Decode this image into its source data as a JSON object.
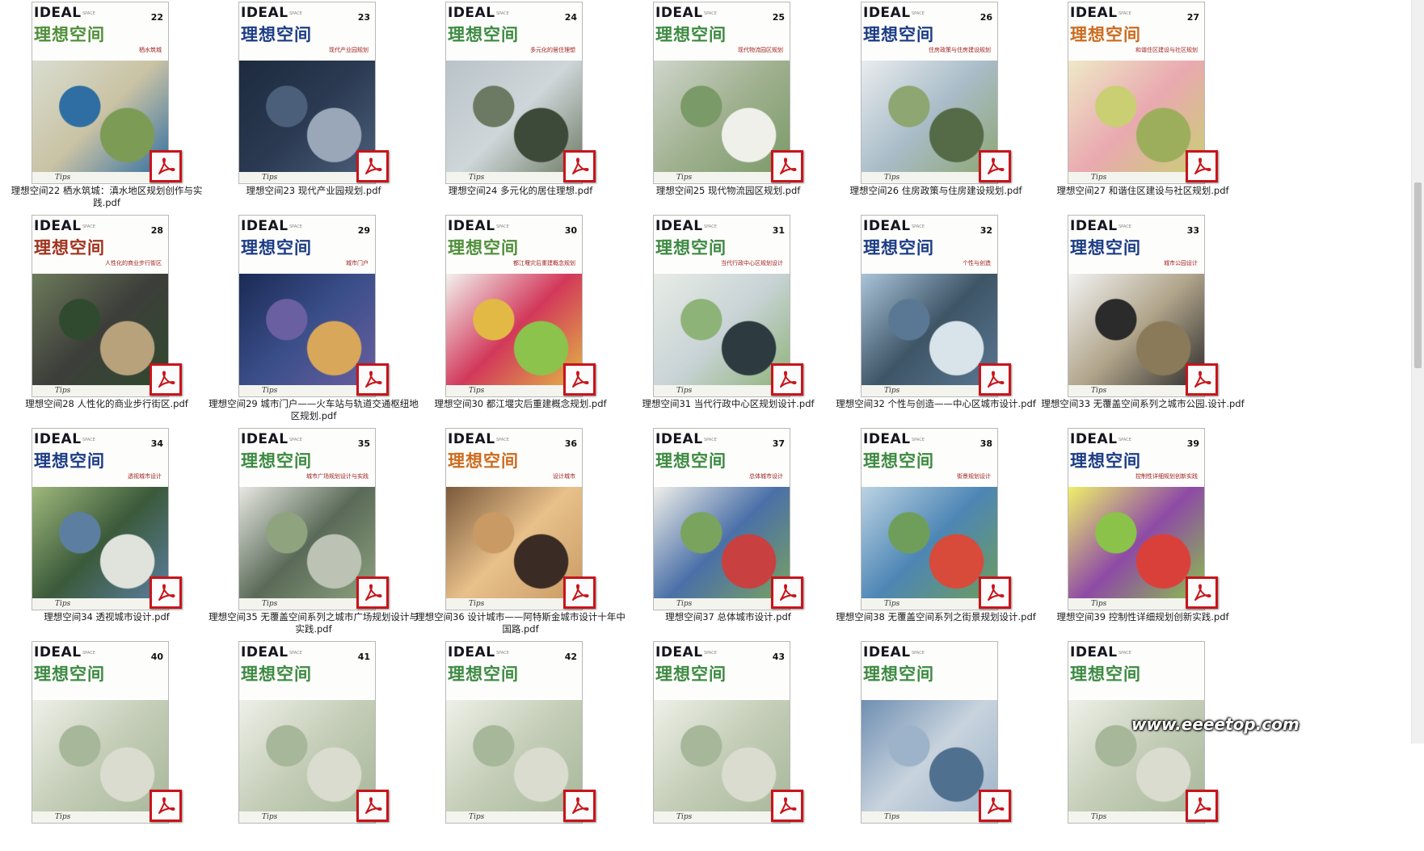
{
  "cover": {
    "brand": "IDEAL",
    "space_word": "SPACE",
    "cn_title": "理想空间",
    "tips": "Tips"
  },
  "files": [
    {
      "issue": "22",
      "subtitle": "栖水筑城",
      "filename": "理想空间22 栖水筑城：滇水地区规划创作与实践.pdf",
      "title_color": "#4f8f3a",
      "palette": [
        "#d9ddd0",
        "#2f6ea2",
        "#7c9b54",
        "#c9c2a4"
      ]
    },
    {
      "issue": "23",
      "subtitle": "现代产业园规划",
      "filename": "理想空间23 现代产业园规划.pdf",
      "title_color": "#1c3c86",
      "palette": [
        "#1d2a3e",
        "#4c5f7a",
        "#9aa7b8",
        "#2b3a52"
      ]
    },
    {
      "issue": "24",
      "subtitle": "多元化的居住理想",
      "filename": "理想空间24 多元化的居住理想.pdf",
      "title_color": "#3d8a42",
      "palette": [
        "#b9c3c9",
        "#6d7a63",
        "#3d4a3a",
        "#cfd6d9"
      ]
    },
    {
      "issue": "25",
      "subtitle": "现代物流园区规划",
      "filename": "理想空间25 现代物流园区规划.pdf",
      "title_color": "#3d8a42",
      "palette": [
        "#cfd5cb",
        "#7a9a68",
        "#f0f0ea",
        "#9fb08f"
      ]
    },
    {
      "issue": "26",
      "subtitle": "住房政策与住房建设规划",
      "filename": "理想空间26 住房政策与住房建设规划.pdf",
      "title_color": "#1c3c86",
      "palette": [
        "#e9ecef",
        "#8ea671",
        "#556b48",
        "#a9bcc8"
      ]
    },
    {
      "issue": "27",
      "subtitle": "和谐住区建设与社区规划",
      "filename": "理想空间27 和谐住区建设与社区规划.pdf",
      "title_color": "#cc6b1f",
      "palette": [
        "#eee9c6",
        "#c9cf72",
        "#9cae5c",
        "#e9a9b0"
      ]
    },
    {
      "issue": "28",
      "subtitle": "人性化的商业步行街区",
      "filename": "理想空间28 人性化的商业步行街区.pdf",
      "title_color": "#a0331f",
      "palette": [
        "#6c7a5a",
        "#2f4a2e",
        "#b7a27b",
        "#3d3e3a"
      ]
    },
    {
      "issue": "29",
      "subtitle": "城市门户",
      "filename": "理想空间29 城市门户——火车站与轨道交通枢纽地区规划.pdf",
      "title_color": "#1c3c86",
      "palette": [
        "#1b2a55",
        "#6a5fa0",
        "#d9a75a",
        "#3b4f8a"
      ]
    },
    {
      "issue": "30",
      "subtitle": "都江堰灾后重建概念规划",
      "filename": "理想空间30 都江堰灾后重建概念规划.pdf",
      "title_color": "#4f8f3a",
      "palette": [
        "#f2f2ee",
        "#e2b945",
        "#8cc34c",
        "#d2385a"
      ]
    },
    {
      "issue": "31",
      "subtitle": "当代行政中心区规划设计",
      "filename": "理想空间31 当代行政中心区规划设计.pdf",
      "title_color": "#3d8a42",
      "palette": [
        "#e7ece5",
        "#8db379",
        "#2d3a3f",
        "#c9d3d6"
      ]
    },
    {
      "issue": "32",
      "subtitle": "个性与创造",
      "filename": "理想空间32 个性与创造——中心区城市设计.pdf",
      "title_color": "#1c3c86",
      "palette": [
        "#a9c3d9",
        "#5a7893",
        "#d8e3ea",
        "#3e5566"
      ]
    },
    {
      "issue": "33",
      "subtitle": "城市公园设计",
      "filename": "理想空间33 无覆盖空间系列之城市公园.设计.pdf",
      "title_color": "#1c3c86",
      "palette": [
        "#f2f2f2",
        "#2b2b2b",
        "#8a7a5a",
        "#b0a48a"
      ]
    },
    {
      "issue": "34",
      "subtitle": "透视城市设计",
      "filename": "理想空间34 透视城市设计.pdf",
      "title_color": "#1c3c86",
      "palette": [
        "#9fb87c",
        "#5c7fa1",
        "#dfe3dc",
        "#3b5a3a"
      ]
    },
    {
      "issue": "35",
      "subtitle": "城市广场规划设计与实践",
      "filename": "理想空间35 无覆盖空间系列之城市广场规划设计与实践.pdf",
      "title_color": "#3d8a42",
      "palette": [
        "#e7e8e2",
        "#8fa37f",
        "#bcc3b4",
        "#5a6a58"
      ]
    },
    {
      "issue": "36",
      "subtitle": "设计城市",
      "filename": "理想空间36 设计城市——阿特斯金城市设计十年中国路.pdf",
      "title_color": "#cc6b1f",
      "palette": [
        "#7b5a3c",
        "#c99a64",
        "#3a2c24",
        "#e8c08a"
      ]
    },
    {
      "issue": "37",
      "subtitle": "总体城市设计",
      "filename": "理想空间37 总体城市设计.pdf",
      "title_color": "#3d8a42",
      "palette": [
        "#f0efe9",
        "#7aa35e",
        "#c84040",
        "#4a70a8"
      ]
    },
    {
      "issue": "38",
      "subtitle": "街景规划设计",
      "filename": "理想空间38 无覆盖空间系列之街景规划设计.pdf",
      "title_color": "#3d8a42",
      "palette": [
        "#bcd3e2",
        "#6e9e5a",
        "#d84a3a",
        "#4d86b5"
      ]
    },
    {
      "issue": "39",
      "subtitle": "控制性详细规划创新实践",
      "filename": "理想空间39 控制性详细规划创新实践.pdf",
      "title_color": "#1c3c86",
      "palette": [
        "#eef06a",
        "#8bc34a",
        "#d9403a",
        "#8e4aa6"
      ]
    },
    {
      "issue": "40",
      "subtitle": "",
      "filename": "",
      "title_color": "#3d8a42",
      "palette": [
        "#eef0e8",
        "#a7b79a",
        "#d9dccf",
        "#c4cdb7"
      ]
    },
    {
      "issue": "41",
      "subtitle": "",
      "filename": "",
      "title_color": "#3d8a42",
      "palette": [
        "#eef0e8",
        "#a7b79a",
        "#d9dccf",
        "#c4cdb7"
      ]
    },
    {
      "issue": "42",
      "subtitle": "",
      "filename": "",
      "title_color": "#3d8a42",
      "palette": [
        "#eef0e8",
        "#a7b79a",
        "#d9dccf",
        "#c4cdb7"
      ]
    },
    {
      "issue": "43",
      "subtitle": "",
      "filename": "",
      "title_color": "#3d8a42",
      "palette": [
        "#eef0e8",
        "#a7b79a",
        "#d9dccf",
        "#c4cdb7"
      ]
    },
    {
      "issue": "",
      "subtitle": "",
      "filename": "",
      "title_color": "#3d8a42",
      "palette": [
        "#6f8fb2",
        "#9db3c9",
        "#50708f",
        "#c8d3dd"
      ]
    },
    {
      "issue": "",
      "subtitle": "",
      "filename": "",
      "title_color": "#3d8a42",
      "palette": [
        "#eef0e8",
        "#a7b79a",
        "#d9dccf",
        "#c4cdb7"
      ]
    }
  ],
  "watermark": "www.eeeetop.com",
  "colors": {
    "badge_border": "#c8141b",
    "acrobat_red": "#c8141b"
  }
}
